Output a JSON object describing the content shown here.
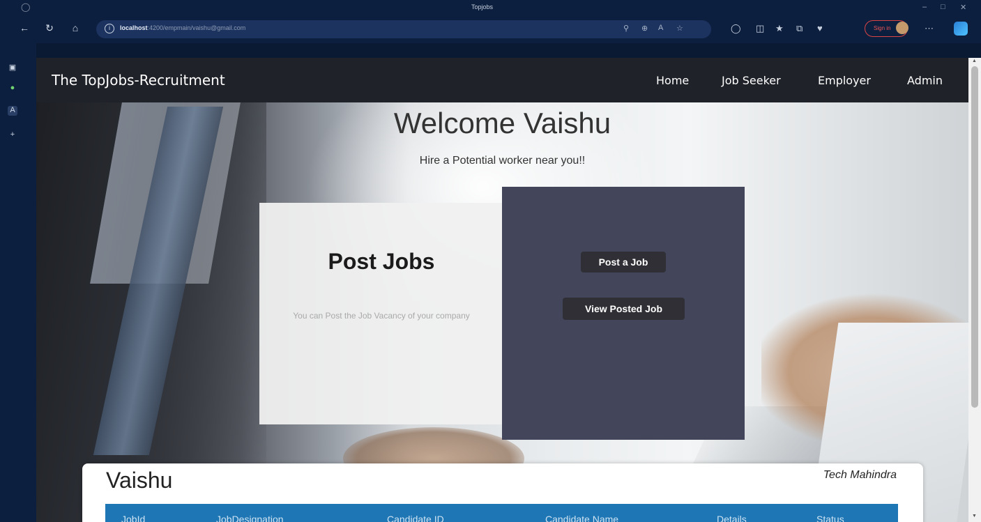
{
  "browser": {
    "tab_title": "Topjobs",
    "url_host": "localhost",
    "url_path": ":4200/empmain/vaishu@gmail.com",
    "sign_in_label": "Sign in",
    "icons": [
      "back-icon",
      "refresh-icon",
      "home-icon",
      "info-icon",
      "search-icon",
      "zoom-icon",
      "read-aloud-icon",
      "favorite-icon",
      "extensions-icon",
      "split-screen-icon",
      "favorites-icon",
      "collections-icon",
      "browser-essentials-icon",
      "profile-icon",
      "more-icon",
      "copilot-icon"
    ]
  },
  "navbar": {
    "brand": "The TopJobs-Recruitment",
    "links": [
      "Home",
      "Job Seeker",
      "Employer",
      "Admin"
    ]
  },
  "hero": {
    "welcome": "Welcome Vaishu",
    "tagline": "Hire a Potential worker near you!!"
  },
  "post_card": {
    "title": "Post Jobs",
    "description": "You can Post the Job Vacancy of your company"
  },
  "actions": {
    "post_job": "Post a Job",
    "view_posted": "View Posted Job"
  },
  "panel": {
    "name": "Vaishu",
    "company": "Tech Mahindra",
    "columns": [
      "JobId",
      "JobDesignation",
      "Candidate ID",
      "Candidate Name",
      "Details",
      "Status"
    ]
  },
  "colors": {
    "navbar": "#1f2229",
    "dark_card": "#43465a",
    "table_header": "#1e77b4",
    "button": "#2f2f35"
  }
}
